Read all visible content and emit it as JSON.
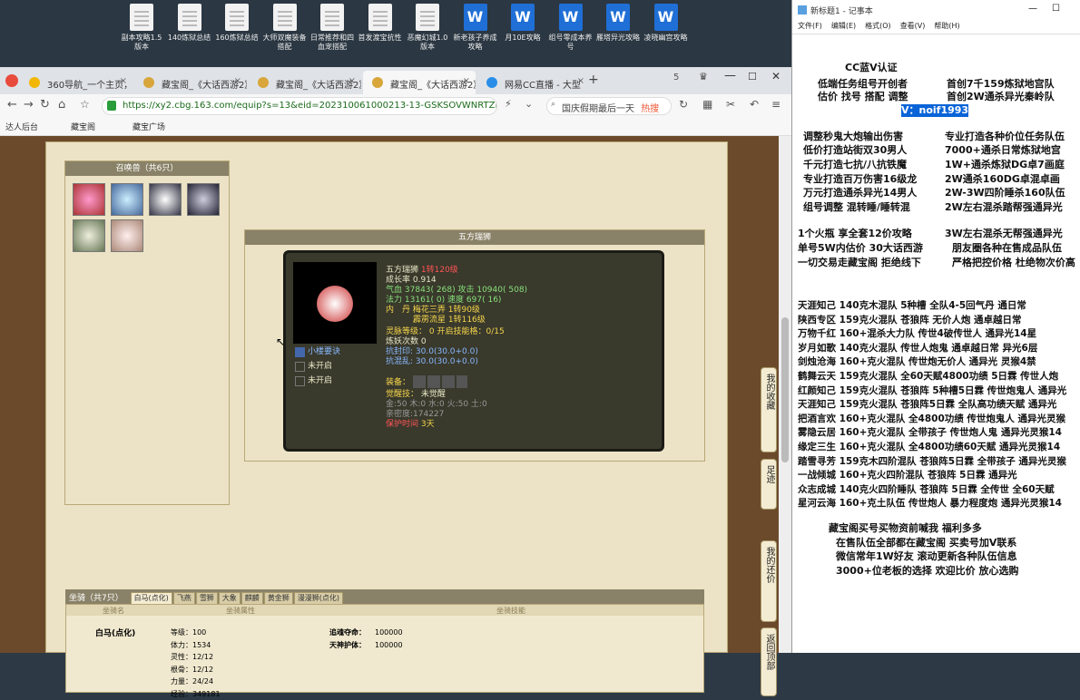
{
  "desktop": {
    "icons": [
      {
        "label": "副本攻略1.5版本",
        "kind": "doc"
      },
      {
        "label": "140炼狱总结",
        "kind": "doc"
      },
      {
        "label": "160炼狱总结",
        "kind": "doc"
      },
      {
        "label": "大师双魔装备搭配",
        "kind": "doc"
      },
      {
        "label": "日常推荐和四血宠搭配",
        "kind": "doc"
      },
      {
        "label": "首发渡宝抗性",
        "kind": "doc"
      },
      {
        "label": "恶魔幻城1.0版本",
        "kind": "doc"
      },
      {
        "label": "新老孩子养成攻略",
        "kind": "word"
      },
      {
        "label": "月10E攻略",
        "kind": "word"
      },
      {
        "label": "组号零成本养号",
        "kind": "word"
      },
      {
        "label": "雁塔异光攻略",
        "kind": "word"
      },
      {
        "label": "凌晓幽宫攻略",
        "kind": "word"
      }
    ]
  },
  "browser": {
    "tabs": [
      {
        "label": "360导航_一个主页，",
        "color": "#f2b705"
      },
      {
        "label": "藏宝阁_《大话西游2》",
        "color": "#d8a63a"
      },
      {
        "label": "藏宝阁_《大话西游2》",
        "color": "#d8a63a"
      },
      {
        "label": "藏宝阁_《大话西游2》",
        "color": "#d8a63a"
      },
      {
        "label": "网易CC直播 - 大型",
        "color": "#2a8ee8"
      }
    ],
    "url": "https://xy2.cbg.163.com/equip?s=13&eid=202310061000213-13-GSKSOVWNRTZIE&o&",
    "search_text": "国庆假期最后一天",
    "search_badge": "热搜",
    "bookmarks": [
      "达人后台",
      "藏宝阁",
      "藏宝广场"
    ]
  },
  "game": {
    "summon_panel_title": "召唤兽（共6只）",
    "pet_panel_title": "五方瑞狮",
    "pet": {
      "name": "五方瑞狮",
      "level": "1转120级",
      "growth_label": "成长率",
      "growth": "0.914",
      "hp_label": "气血",
      "hp": "37843",
      "hp_extra": "( 268)",
      "atk_label": "攻击",
      "atk": "10940",
      "atk_extra": "( 508)",
      "mp_label": "法力",
      "mp": "13161",
      "mp_extra": "( 0)",
      "spd_label": "速度",
      "spd": "697",
      "spd_extra": "( 16)",
      "dan_label": "内　丹",
      "dan1": "梅花三弄 1转90级",
      "dan2": "霹雳流星 1转116级",
      "skill1": "小楼要诀",
      "skill2": "未开启",
      "skill3": "未开启",
      "spirit_label": "灵脉等级：",
      "spirit_level": "0",
      "spirit_skill": "开启技能格：0/15",
      "refine_label": "炼妖次数",
      "refine": "0",
      "res1_label": "抗封印",
      "res1": "30.0(30.0+0.0)",
      "res2_label": "抗混乱",
      "res2": "30.0(30.0+0.0)",
      "equip_label": "装备：",
      "awaken_label": "觉醒技：",
      "awaken": "未觉醒",
      "elements": "金:50 木:0 水:0 火:50 土:0",
      "intimacy": "亲密度:174227",
      "protect": "保护时间",
      "protect_days": "3天"
    },
    "mount": {
      "title": "坐骑（共7只）",
      "tabs": [
        "白马(点化)",
        "飞燕",
        "雪狮",
        "大象",
        "麒麟",
        "黄金狮",
        "漫漫狮(点化)"
      ],
      "headers": [
        "坐骑名",
        "坐骑属性",
        "坐骑技能"
      ],
      "name": "白马(点化)",
      "stats": [
        {
          "k": "等级：",
          "v": "100"
        },
        {
          "k": "体力：",
          "v": "1534"
        },
        {
          "k": "灵性：",
          "v": "12/12"
        },
        {
          "k": "根骨：",
          "v": "12/12"
        },
        {
          "k": "力量：",
          "v": "24/24"
        },
        {
          "k": "经验：",
          "v": "349181"
        }
      ],
      "skills": [
        {
          "k": "追魂夺命：",
          "v": "100000"
        },
        {
          "k": "天神护体：",
          "v": "100000"
        }
      ]
    },
    "side_buttons": [
      "我的收藏",
      "足迹",
      "我的还价",
      "返回顶部"
    ]
  },
  "notepad": {
    "title": "新标题1 - 记事本",
    "menu": [
      "文件(F)",
      "编辑(E)",
      "格式(O)",
      "查看(V)",
      "帮助(H)"
    ],
    "header_lines": [
      "CC蓝V认证",
      "低端任务组号开创者",
      "首创7千159炼狱地宫队",
      "估价 找号 搭配 调整",
      "首创2W通杀异光秦岭队",
      "V：noif1993"
    ],
    "left_lines": [
      "调整秒鬼大炮输出伤害",
      "低价打造站街双30男人",
      "千元打造七抗/八抗铁魔",
      "专业打造百万伤害16级龙",
      "万元打造通杀异光14男人",
      "组号调整 混转睡/睡转混",
      "1个火瓶 享全套12价攻略",
      "单号5W内估价 30大话西游",
      "一切交易走藏宝阁 拒绝线下"
    ],
    "right_lines": [
      "专业打造各种价位任务队伍",
      "7000+通杀日常炼狱地宫",
      "1W+通杀炼狱DG卓7画庭",
      "2W通杀160DG卓混卓画",
      "2W-3W四阶睡杀160队伍",
      "2W左右混杀踏帮强通异光",
      "3W左右混杀无帮强通异光",
      "朋友圈各种在售成品队伍",
      "严格把控价格 杜绝物次价高"
    ],
    "team_lines": [
      "天涯知己 140克木混队 5种槽 全队4-5回气丹 通日常",
      "陕西专区 159克火混队 苍狼阵 无价人炮 通卓越日常",
      "万物千红 160+混杀大力队 传世4破传世人 通异光14星",
      "岁月如歌 140克火混队 传世人炮鬼 通卓越日常 异光6层",
      "剑烛沧海 160+克火混队 传世炮无价人 通异光 灵猴4禁",
      "鹤舞云天 159克火混队 全60天赋4800功绩 5日霖 传世人炮",
      "红颜知己 159克火混队 苍狼阵 5种槽5日霖 传世炮鬼人 通异光",
      "天涯知己 159克火混队 苍狼阵5日霖 全队高功绩天赋 通异光",
      "把酒言欢 160+克火混队 全4800功绩 传世炮鬼人 通异光灵猴",
      "雾隐云居 160+克火混队 全带孩子 传世炮人鬼 通异光灵猴14",
      "缘定三生 160+克火混队 全4800功绩60天赋 通异光灵猴14",
      "踏雪寻芳 159克木四阶混队 苍狼阵5日霖 全带孩子 通异光灵猴",
      "一战倾城 160+克火四阶混队 苍狼阵 5日霖 通异光",
      "众志成城 140克火四阶睡队 苍狼阵 5日霖 全传世 全60天赋",
      "星河云海 160+克土队伍 传世炮人 暴力程度炮 通异光灵猴14"
    ],
    "footer_lines": [
      "藏宝阁买号买物资前喊我 福利多多",
      "在售队伍全部都在藏宝阁 买卖号加V联系",
      "微信常年1W好友 滚动更新各种队伍信息",
      "3000+位老板的选择 欢迎比价 放心选购"
    ]
  }
}
